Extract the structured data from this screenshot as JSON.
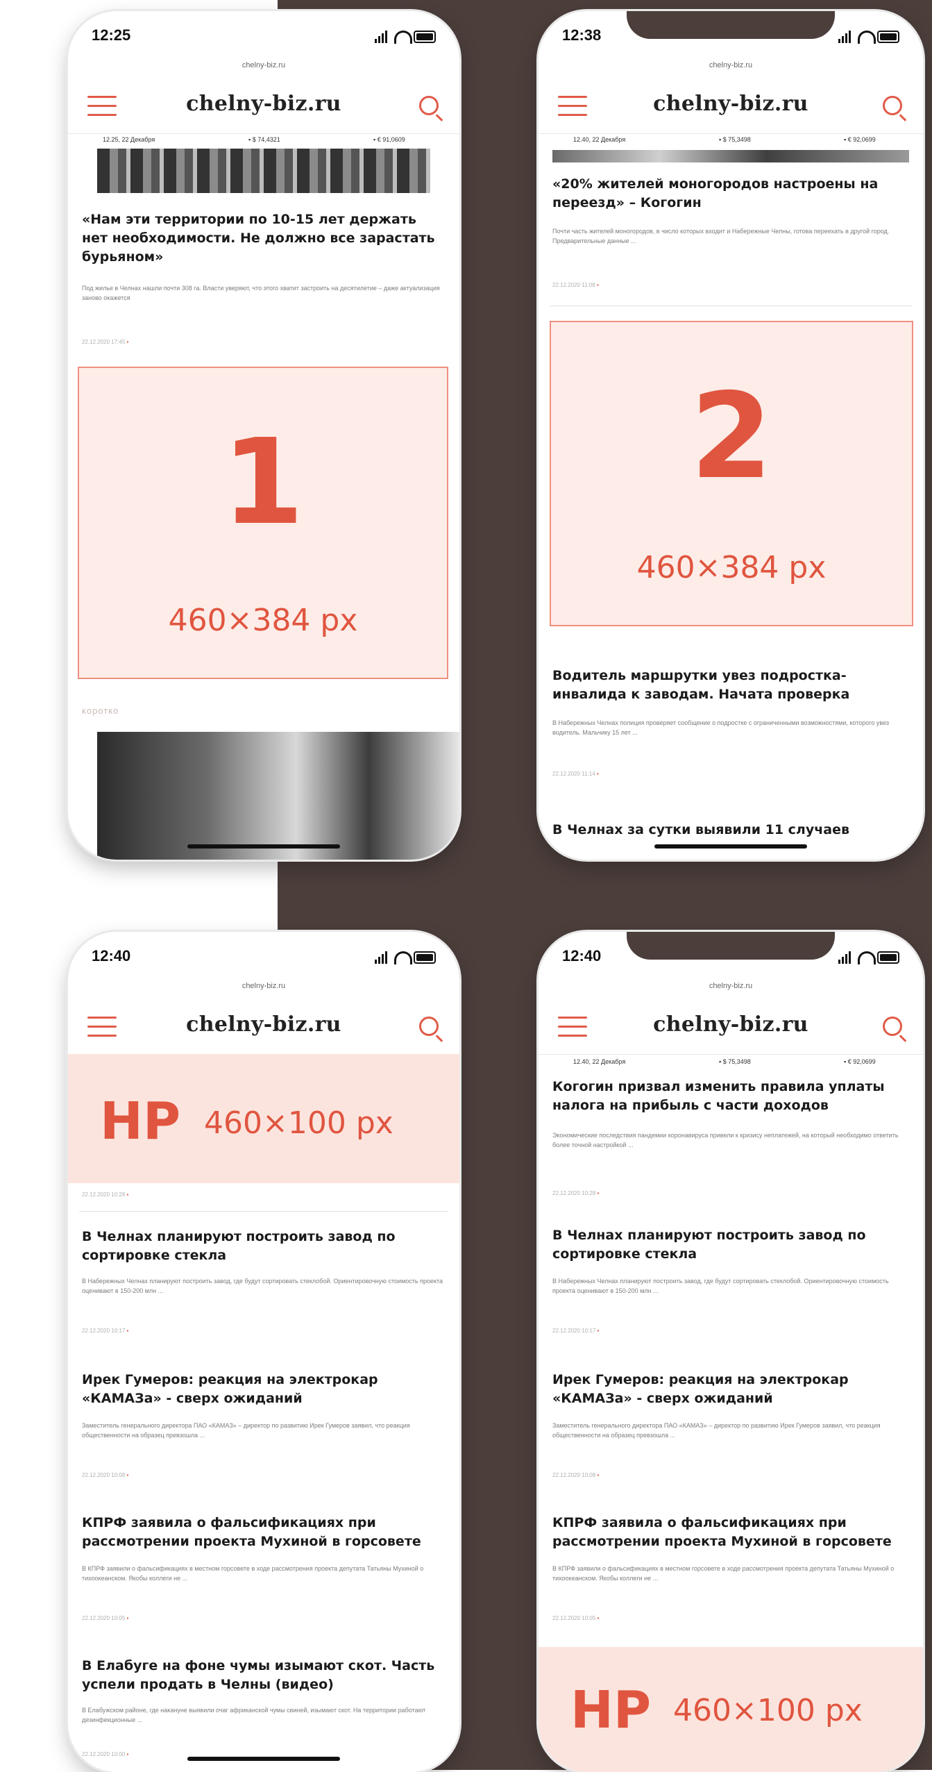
{
  "colors": {
    "accent": "#e0553f",
    "ad_fill": "#fdece8",
    "dark_bg": "#4b3e3b"
  },
  "icons": {
    "menu": "hamburger-icon",
    "search": "search-icon",
    "wifi": "wifi-icon",
    "battery": "battery-icon",
    "signal": "signal-icon"
  },
  "site": {
    "logo": "chelny-biz.ru",
    "url": "chelny-biz.ru"
  },
  "ticker": {
    "date1": "12.25, 22 Декабря",
    "usd1": "▪ $ 74,4321",
    "eur1": "▪ € 91,0609",
    "date2": "12.40, 22 Декабря",
    "usd2": "▪ $ 75,3498",
    "eur2": "▪ € 92,0699"
  },
  "phones": [
    {
      "time": "12:25",
      "article1": {
        "title": "«Нам эти территории по 10-15 лет держать нет необходимости. Не должно все зарастать бурьяном»",
        "lead": "Под жилье в Челнах нашли почти 308 га. Власти уверяют, что этого хватит застроить на десятилетие – даже актуализация заново окажется",
        "meta": "22.12.2020 17:45"
      },
      "ad": {
        "number": "1",
        "size": "460×384 px"
      },
      "section": "коротко"
    },
    {
      "time": "12:38",
      "article1": {
        "title": "«20% жителей моногородов настроены на переезд» – Когогин",
        "lead": "Почти часть жителей моногородов, в число которых входит и Набережные Челны, готова переехать в другой город. Предварительные данные ...",
        "meta": "22.12.2020 11:08"
      },
      "ad": {
        "number": "2",
        "size": "460×384 px"
      },
      "article2": {
        "title": "Водитель маршрутки увез подростка-инвалида к заводам. Начата проверка",
        "lead": "В Набережных Челнах полиция проверяет сообщение о подростке с ограниченными возможностями, которого увез водитель. Мальчику 15 лет ...",
        "meta": "22.12.2020 11:14"
      },
      "article3": {
        "title": "В Челнах за сутки выявили 11 случаев"
      }
    },
    {
      "time": "12:40",
      "hp": {
        "label": "HP",
        "size": "460×100 px"
      },
      "meta0": "22.12.2020 10:28",
      "articles": [
        {
          "title": "В Челнах планируют построить завод по сортировке стекла",
          "lead": "В Набережных Челнах планируют построить завод, где будут сортировать стеклобой. Ориентировочную стоимость проекта оценивают в 150-200 млн ...",
          "meta": "22.12.2020 10:17"
        },
        {
          "title": "Ирек Гумеров: реакция на электрокар «КАМАЗа» - сверх ожиданий",
          "lead": "Заместитель генерального директора ПАО «КАМАЗ» – директор по развитию Ирек Гумеров заявил, что реакция общественности на образец превзошла ...",
          "meta": "22.12.2020 10:08"
        },
        {
          "title": "КПРФ заявила о фальсификациях при рассмотрении проекта Мухиной в горсовете",
          "lead": "В КПРФ заявили о фальсификациях в местном горсовете в ходе рассмотрения проекта депутата Татьяны Мухиной о тихоокеанском. Якобы коллеги не ...",
          "meta": "22.12.2020 10:05"
        },
        {
          "title": "В Елабуге на фоне чумы изымают скот. Часть успели продать в Челны (видео)",
          "lead": "В Елабужском районе, где накануне выявили очаг африканской чумы свиней, изымают скот. На территории работают дезинфекционные ...",
          "meta": "22.12.2020 10:00"
        }
      ]
    },
    {
      "time": "12:40",
      "article0": {
        "title": "Когогин призвал изменить правила уплаты налога на прибыль с части доходов",
        "lead": "Экономические последствия пандемии коронавируса привели к кризису неплатежей, на который необходимо ответить более точной настройкой ...",
        "meta": "22.12.2020 10:28"
      },
      "articles": [
        {
          "title": "В Челнах планируют построить завод по сортировке стекла",
          "lead": "В Набережных Челнах планируют построить завод, где будут сортировать стеклобой. Ориентировочную стоимость проекта оценивают в 150-200 млн ...",
          "meta": "22.12.2020 10:17"
        },
        {
          "title": "Ирек Гумеров: реакция на электрокар «КАМАЗа» - сверх ожиданий",
          "lead": "Заместитель генерального директора ПАО «КАМАЗ» – директор по развитию Ирек Гумеров заявил, что реакция общественности на образец превзошла ...",
          "meta": "22.12.2020 10:08"
        },
        {
          "title": "КПРФ заявила о фальсификациях при рассмотрении проекта Мухиной в горсовете",
          "lead": "В КПРФ заявили о фальсификациях в местном горсовете в ходе рассмотрения проекта депутата Татьяны Мухиной о тихоокеанском. Якобы коллеги не ...",
          "meta": "22.12.2020 10:05"
        }
      ],
      "hp": {
        "label": "HP",
        "size": "460×100 px"
      }
    }
  ]
}
